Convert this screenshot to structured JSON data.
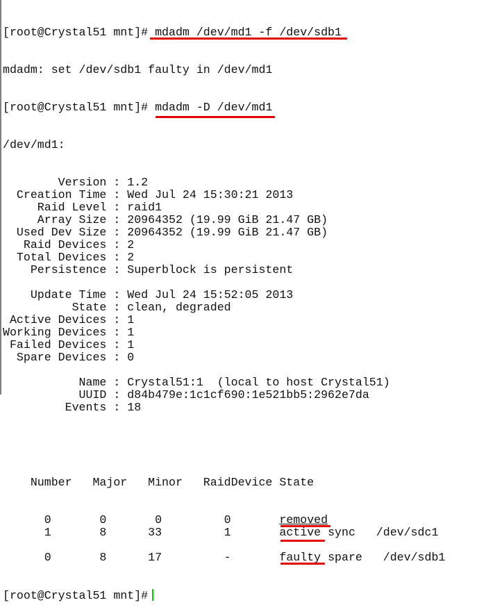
{
  "terminal": {
    "prompt": "[root@Crystal51 mnt]#",
    "command1": " mdadm /dev/md1 -f /dev/sdb1",
    "output1": "mdadm: set /dev/sdb1 faulty in /dev/md1",
    "command2": " mdadm -D /dev/md1",
    "device_header": "/dev/md1:",
    "details": [
      {
        "key": "        Version",
        "value": "1.2"
      },
      {
        "key": "  Creation Time",
        "value": "Wed Jul 24 15:30:21 2013"
      },
      {
        "key": "     Raid Level",
        "value": "raid1"
      },
      {
        "key": "     Array Size",
        "value": "20964352 (19.99 GiB 21.47 GB)"
      },
      {
        "key": "  Used Dev Size",
        "value": "20964352 (19.99 GiB 21.47 GB)"
      },
      {
        "key": "   Raid Devices",
        "value": "2"
      },
      {
        "key": "  Total Devices",
        "value": "2"
      },
      {
        "key": "    Persistence",
        "value": "Superblock is persistent"
      },
      {
        "key": "",
        "value": ""
      },
      {
        "key": "    Update Time",
        "value": "Wed Jul 24 15:52:05 2013"
      },
      {
        "key": "          State",
        "value": "clean, degraded"
      },
      {
        "key": " Active Devices",
        "value": "1"
      },
      {
        "key": "Working Devices",
        "value": "1"
      },
      {
        "key": " Failed Devices",
        "value": "1"
      },
      {
        "key": "  Spare Devices",
        "value": "0"
      },
      {
        "key": "",
        "value": ""
      },
      {
        "key": "           Name",
        "value": "Crystal51:1  (local to host Crystal51)"
      },
      {
        "key": "           UUID",
        "value": "d84b479e:1c1cf690:1e521bb5:2962e7da"
      },
      {
        "key": "         Events",
        "value": "18"
      }
    ],
    "table_header": "    Number   Major   Minor   RaidDevice State",
    "rows": [
      {
        "number": "0",
        "major": "0",
        "minor": "0",
        "raiddevice": "0",
        "state": "removed",
        "device": ""
      },
      {
        "number": "1",
        "major": "8",
        "minor": "33",
        "raiddevice": "1",
        "state": "active sync",
        "device": "/dev/sdc1"
      },
      {
        "number": "0",
        "major": "8",
        "minor": "17",
        "raiddevice": "-",
        "state": "faulty spare",
        "device": "/dev/sdb1"
      }
    ],
    "highlight_color": "#e00000",
    "cursor_color": "#00d000"
  }
}
